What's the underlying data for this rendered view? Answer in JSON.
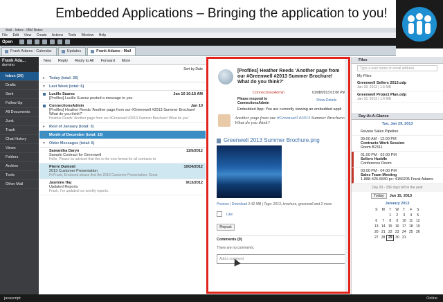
{
  "slide_title": "Embedded Applications – Bringing the application to you!",
  "window": {
    "title": "Mail - Inbox - IBM Notes"
  },
  "menu": [
    "File",
    "Edit",
    "View",
    "Create",
    "Actions",
    "Tools",
    "Window",
    "Help"
  ],
  "toolbar": {
    "open_label": "Open"
  },
  "tabs": [
    {
      "label": "Frank Adams - Calendar"
    },
    {
      "label": "Updates"
    },
    {
      "label": "Frank Adams - Mail"
    }
  ],
  "sidebar": {
    "user": "Frank Ada...",
    "domain": "domino",
    "items": [
      "Inbox (20)",
      "Drafts",
      "Sent",
      "Follow Up",
      "All Documents",
      "Junk",
      "Trash",
      "Chat History",
      "Views",
      "Folders",
      "Archive",
      "Tools",
      "Other Mail"
    ]
  },
  "mail_toolbar": [
    "New",
    "Reply",
    "Reply to All",
    "Forward",
    "More"
  ],
  "sort_label": "Sort by Date",
  "groups": {
    "today": "Today (total: 25)",
    "last_week": "Last Week (total: 6)",
    "rest_january": "Rest of January (total: 3)",
    "december": "Month of December (total: 15)",
    "older": "Older Messages (total: 6)"
  },
  "messages": [
    {
      "from": "Lucille Suarez",
      "date": "Jan 10 10:15 AM",
      "subject": "[Profiles] Lucille Suarez posted a message to you",
      "preview": ""
    },
    {
      "from": "ConnectionsAdmin",
      "date": "Jan 10",
      "subject": "[Profiles] Heather Reeds 'Another page from our #Greenwell #2013 Summer Brochure! What do you think?'",
      "preview": "Heather Reeds 'Another page from our #Greenwell #2013 Summer Brochure! What do you'"
    },
    {
      "from": "Samantha Daryn",
      "date": "11/5/2012",
      "subject": "Sample Contract for Greenwell",
      "preview": "Hello,  Please be advised that this is the new format for all contracts to"
    },
    {
      "from": "Pierre Dumont",
      "date": "10/24/2012",
      "subject": "2013 Customer Presentation",
      "preview": "Hi Frank, Enclosed please find the 2013 Customer Presentation. Great"
    },
    {
      "from": "Jasmine Haj",
      "date": "9/13/2012",
      "subject": "Updated Reports",
      "preview": "Frank, I've updated our weekly reports."
    }
  ],
  "reader": {
    "subject": "[Profiles] Heather Reeds 'Another page from our #Greenwell #2013 Summer Brochure! What do you think?'",
    "sender": "ConnectionsAdmin",
    "date": "01/08/2013 01:00 PM",
    "please_respond": "Please respond to ConnectionsAdmin",
    "show_details": "Show Details",
    "embedded_text": "Embedded App: You are currently viewing an embedded appli",
    "quote_prefix": "Another page from our",
    "quote_tag": "#Greenwell #2013",
    "quote_suffix": "Summer Brochure! What do you think?",
    "file_name": "Greenwell 2013 Summer Brochure.png",
    "file_meta_links": "Preview  |  Download",
    "file_meta": "2.42 MB  |  Tags: 2013, brochure, greenwell and 2 more",
    "like": "Like",
    "repost": "Repost",
    "comments": "Comments (0)",
    "no_comments": "There are no comments.",
    "add_comment": "Add a comment"
  },
  "files": {
    "header": "Files",
    "sub": "My Files",
    "search_placeholder": "Type a user name or email address",
    "items": [
      {
        "name": "Greenwell Sellers 2013.odp",
        "meta": "Jan 18, 2013  |  1.5 MB"
      },
      {
        "name": "Greenwell Project Plan.odp",
        "meta": "Jan 16, 2013  |  1.4 MB"
      }
    ]
  },
  "calendar": {
    "header": "Day-At-A-Glance",
    "date": "Tue, Jan 29, 2013",
    "events": [
      {
        "time": "",
        "title": "Review Sales Pipeline",
        "place": ""
      },
      {
        "time": "09:00 AM - 12:00 PM",
        "title": "Contracts Work Session",
        "place": "Room B2311"
      },
      {
        "time": "01:00 PM - 02:00 PM",
        "title": "Sellers Huddle",
        "place": "Conference Room"
      },
      {
        "time": "03:00 PM - 04:00 PM",
        "title": "Sales Team Meeting",
        "place": "1-888-426-6840 pc: 4156205  Frank Adams"
      }
    ],
    "days_left": "Day 29 - 336 days left in the year",
    "today_btn": "Today",
    "today_date": "Jan 15, 2013",
    "mini_title": "January  2013",
    "weekdays": [
      "S",
      "M",
      "T",
      "W",
      "T",
      "F",
      "S"
    ],
    "weeks": [
      [
        "",
        "",
        "1",
        "2",
        "3",
        "4",
        "5"
      ],
      [
        "6",
        "7",
        "8",
        "9",
        "10",
        "11",
        "12"
      ],
      [
        "13",
        "14",
        "15",
        "16",
        "17",
        "18",
        "19"
      ],
      [
        "20",
        "21",
        "22",
        "23",
        "24",
        "25",
        "26"
      ],
      [
        "27",
        "28",
        "29",
        "30",
        "31",
        "",
        ""
      ]
    ]
  },
  "status": {
    "left": "javascript:",
    "right": "Online"
  }
}
